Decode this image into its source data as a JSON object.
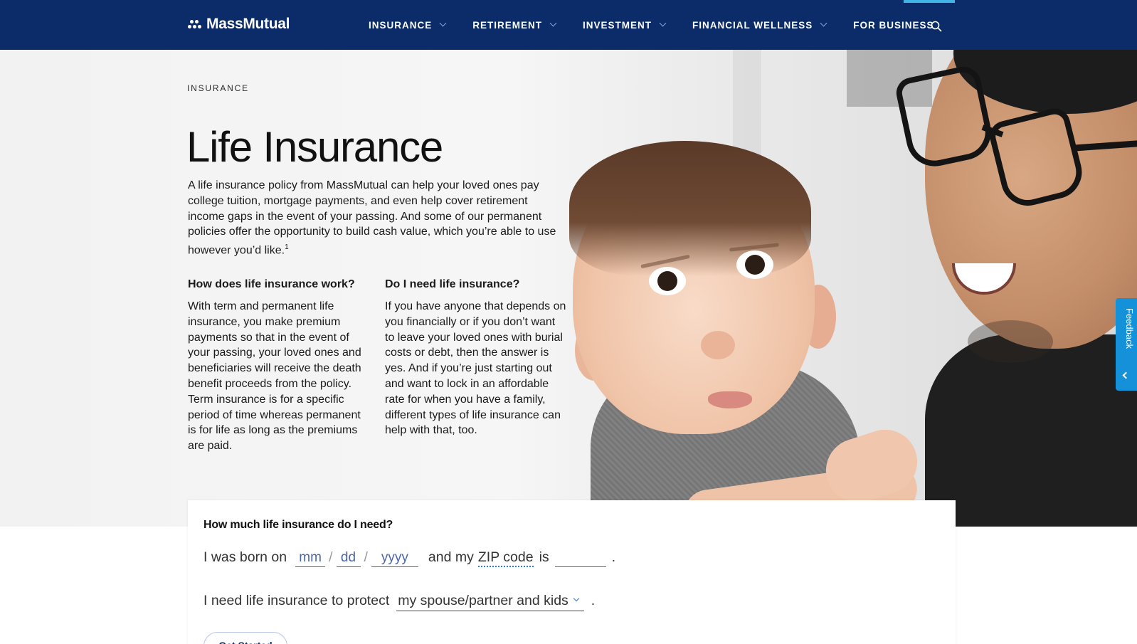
{
  "header": {
    "logo_text": "MassMutual",
    "nav": [
      {
        "label": "INSURANCE",
        "has_dropdown": true
      },
      {
        "label": "RETIREMENT",
        "has_dropdown": true
      },
      {
        "label": "INVESTMENT",
        "has_dropdown": true
      },
      {
        "label": "FINANCIAL WELLNESS",
        "has_dropdown": true
      },
      {
        "label": "FOR BUSINESS",
        "has_dropdown": false
      }
    ],
    "search_icon": "search-icon"
  },
  "hero": {
    "breadcrumb": "INSURANCE",
    "title": "Life Insurance",
    "intro": "A life insurance policy from MassMutual can help your loved ones pay college tuition, mortgage payments, and even help cover retirement income gaps in the event of your passing. And some of our permanent policies offer the opportunity to build cash value, which you’re able to use however you’d like.",
    "intro_footnote": "1",
    "col1": {
      "heading": "How does life insurance work?",
      "body": "With term and permanent life insurance, you make premium payments so that in the event of your passing, your loved ones and beneficiaries will receive the death benefit proceeds from the policy. Term insurance is for a specific period of time whereas permanent is for life as long as the premiums are paid."
    },
    "col2": {
      "heading": "Do I need life insurance?",
      "body": "If you have anyone that depends on you financially or if you don’t want to leave your loved ones with burial costs or debt, then the answer is yes. And if you’re just starting out and want to lock in an affordable rate for when you have a family, different types of life insurance can help with that, too."
    }
  },
  "feedback": {
    "label": "Feedback"
  },
  "calculator": {
    "question": "How much life insurance do I need?",
    "born_prefix": "I was born on",
    "month_placeholder": "mm",
    "day_placeholder": "dd",
    "year_placeholder": "yyyy",
    "slash": "/",
    "zip_prefix": "and my",
    "zip_link": "ZIP code",
    "zip_suffix": "is",
    "period": ".",
    "protect_prefix": "I need life insurance to protect",
    "protect_value": "my spouse/partner and kids",
    "cta": "Get Started"
  },
  "colors": {
    "nav_bg": "#0b2c68",
    "accent_blue": "#1591d9",
    "active_bar": "#3fb4e5"
  }
}
